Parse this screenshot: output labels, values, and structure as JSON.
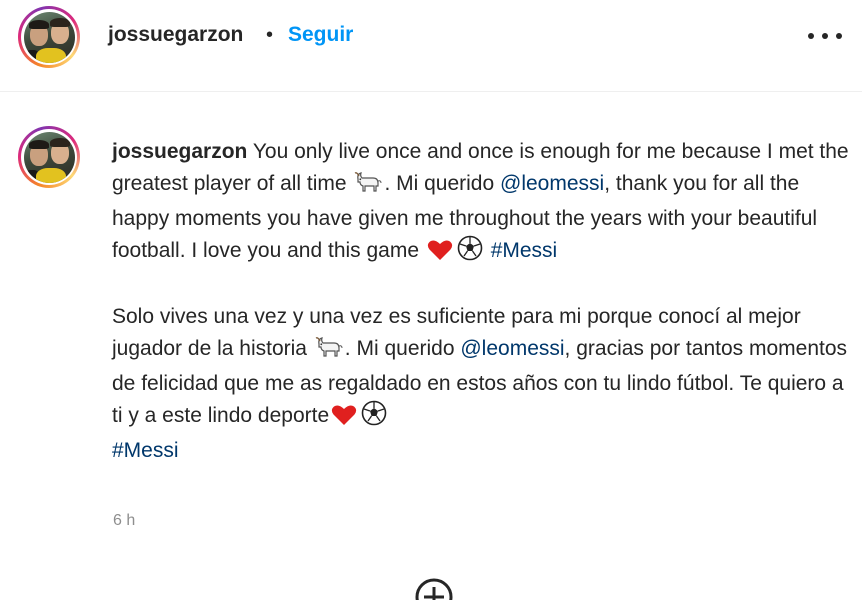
{
  "header": {
    "username": "jossuegarzon",
    "separator": "•",
    "follow_label": "Seguir",
    "more_icon": "more-horizontal-icon"
  },
  "caption": {
    "username": "jossuegarzon",
    "paragraph1": {
      "part1": " You only live once and once is enough for me because I met the greatest player of all time ",
      "emoji_goat": "goat-emoji",
      "part2": ". Mi querido ",
      "mention": "@leomessi",
      "part3": ", thank you for all the happy moments you have given me throughout the years with your beautiful football. I love you and this game ",
      "emoji_heart": "red-heart-emoji",
      "emoji_ball": "soccer-ball-emoji",
      "hashtag": "#Messi"
    },
    "paragraph2": {
      "part1": "Solo vives una vez y una vez es suficiente para mi porque conocí al mejor jugador de la historia ",
      "emoji_goat": "goat-emoji",
      "part2": ". Mi querido ",
      "mention": "@leomessi",
      "part3": ", gracias por tantos momentos de felicidad que me as regaldado en estos años con tu lindo fútbol. Te quiero a ti y a este lindo deporte",
      "emoji_heart": "red-heart-emoji",
      "emoji_ball": "soccer-ball-emoji",
      "hashtag": "#Messi"
    },
    "timestamp": "6 h"
  },
  "load_more_icon": "plus-circle-icon",
  "colors": {
    "follow_blue": "#0095f6",
    "link_blue": "#00376b",
    "text": "#262626",
    "muted": "#8e8e8e"
  }
}
